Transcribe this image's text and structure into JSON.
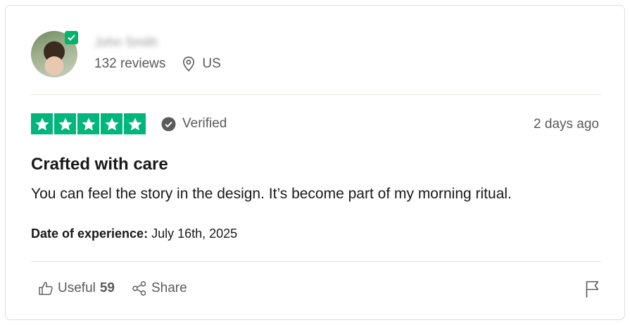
{
  "reviewer": {
    "name": "John Smith",
    "reviews_count": "132 reviews",
    "country": "US"
  },
  "review": {
    "rating": 5,
    "rating_max": 5,
    "verified_label": "Verified",
    "posted_ago": "2 days ago",
    "title": "Crafted with care",
    "body": "You can feel the story in the design. It’s become part of my morning ritual.",
    "experience_label": "Date of experience:",
    "experience_date": "July 16th, 2025"
  },
  "actions": {
    "useful_label": "Useful",
    "useful_count": "59",
    "share_label": "Share"
  },
  "colors": {
    "star_green": "#00b67a",
    "badge_green": "#04b26e",
    "muted_text": "#5a5a5a"
  },
  "icons": [
    "verified-badge-icon",
    "location-pin-icon",
    "star-icon",
    "verified-check-icon",
    "thumbs-up-icon",
    "share-icon",
    "flag-icon"
  ]
}
